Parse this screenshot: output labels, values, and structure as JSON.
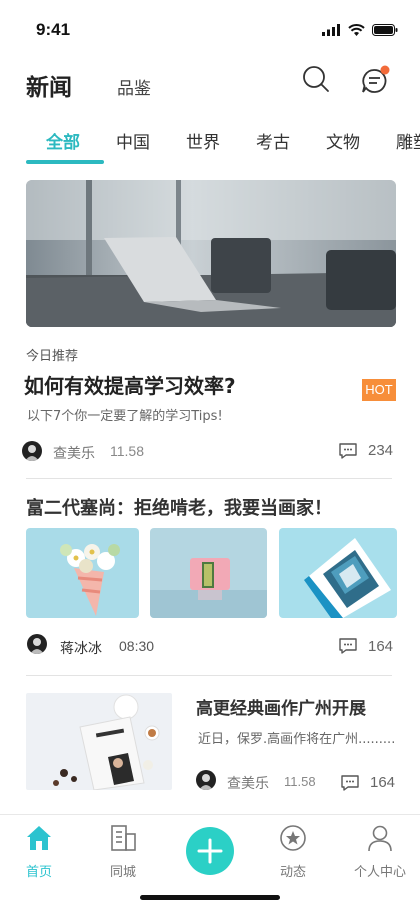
{
  "status_bar": {
    "time": "9:41"
  },
  "header": {
    "title": "新闻",
    "secondary_tab": "品鉴"
  },
  "categories": [
    "全部",
    "中国",
    "世界",
    "考古",
    "文物",
    "雕塑"
  ],
  "articles": [
    {
      "label": "今日推荐",
      "title": "如何有效提高学习效率?",
      "badge": "HOT",
      "subtitle": "以下7个你一定要了解的学习Tips!",
      "author": "查美乐",
      "time": "11.58",
      "comments": "234"
    },
    {
      "title": "富二代塞尚：拒绝啃老，我要当画家！",
      "author": "蒋冰冰",
      "time": "08:30",
      "comments": "164"
    },
    {
      "title": "高更经典画作广州开展",
      "summary": "近日，保罗.高画作将在广州.........",
      "author": "查美乐",
      "time": "11.58",
      "comments": "164"
    }
  ],
  "tab_bar": [
    {
      "label": "首页",
      "icon": "home-icon"
    },
    {
      "label": "同城",
      "icon": "city-icon"
    },
    {
      "label": "",
      "icon": "plus-icon"
    },
    {
      "label": "动态",
      "icon": "star-icon"
    },
    {
      "label": "个人中心",
      "icon": "user-icon"
    }
  ],
  "colors": {
    "accent": "#2cb9c0",
    "hot": "#f78e3a",
    "add_button": "#2bd0c6"
  }
}
